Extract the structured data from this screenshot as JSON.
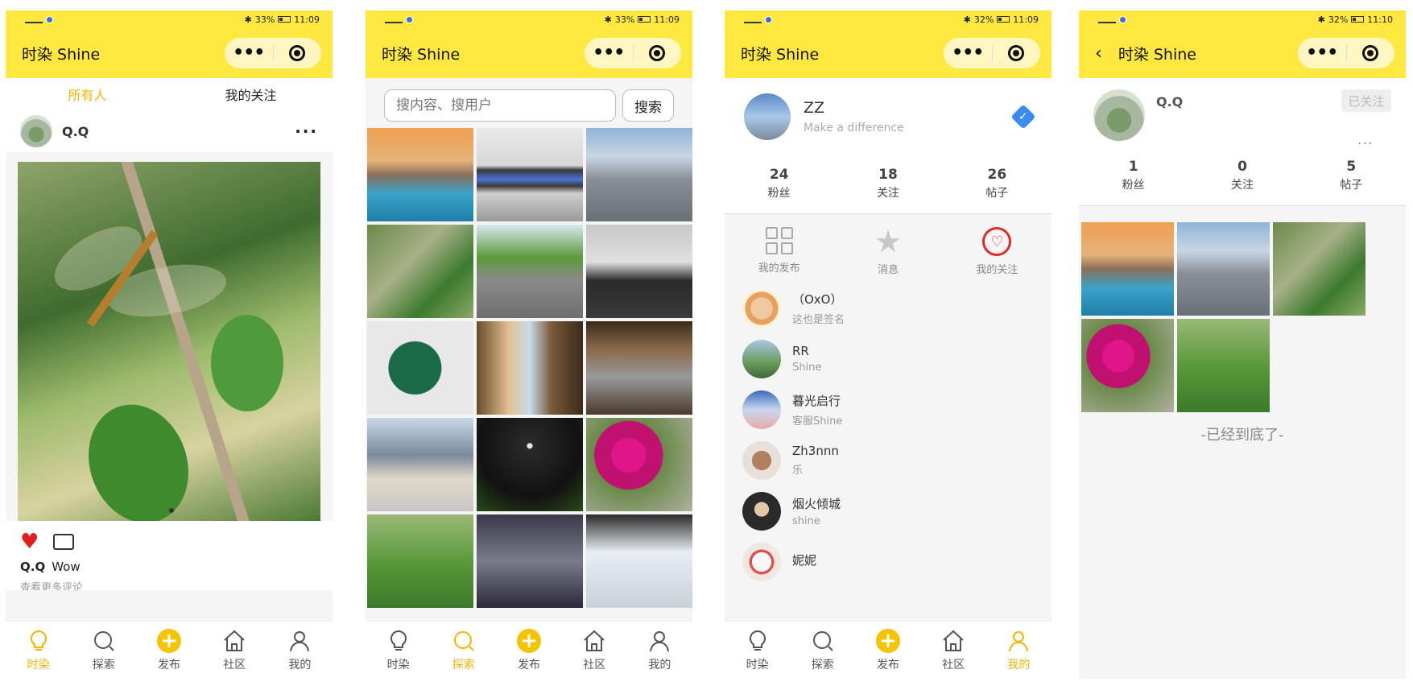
{
  "status": {
    "battery_1": "33%",
    "time_1": "11:09",
    "battery_2": "33%",
    "time_2": "11:09",
    "battery_3": "32%",
    "time_3": "11:09",
    "battery_4": "32%",
    "time_4": "11:10"
  },
  "app_title": "时染 Shine",
  "colors": {
    "accent": "#ffe83f",
    "tab_active": "#f2b600",
    "like": "#e02020",
    "verified": "#3a8cf0"
  },
  "tabbar": {
    "items": [
      {
        "label": "时染",
        "icon": "bulb-icon"
      },
      {
        "label": "探索",
        "icon": "search-icon"
      },
      {
        "label": "发布",
        "icon": "plus-icon"
      },
      {
        "label": "社区",
        "icon": "home-icon"
      },
      {
        "label": "我的",
        "icon": "user-icon"
      }
    ]
  },
  "feed": {
    "tabs": [
      "所有人",
      "我的关注"
    ],
    "post": {
      "user": "Q.Q",
      "more": "···",
      "caption_user": "Q.Q",
      "caption": "Wow",
      "comments_hint": "查看更多评论"
    }
  },
  "explore": {
    "search_placeholder": "搜内容、搜用户",
    "search_button": "搜索"
  },
  "me": {
    "name": "ZZ",
    "bio": "Make a difference",
    "verified_glyph": "✓",
    "stats": [
      {
        "value": "24",
        "label": "粉丝"
      },
      {
        "value": "18",
        "label": "关注"
      },
      {
        "value": "26",
        "label": "帖子"
      }
    ],
    "menu": [
      {
        "label": "我的发布",
        "icon": "grid-icon"
      },
      {
        "label": "消息",
        "icon": "star-icon"
      },
      {
        "label": "我的关注",
        "icon": "heart-icon"
      }
    ],
    "following": [
      {
        "name": "（OxO）",
        "sign": "这也是签名"
      },
      {
        "name": "RR",
        "sign": "Shine"
      },
      {
        "name": "暮光启行",
        "sign": "客服Shine"
      },
      {
        "name": "Zh3nnn",
        "sign": "乐"
      },
      {
        "name": "烟火倾城",
        "sign": "shine"
      },
      {
        "name": "妮妮",
        "sign": ""
      }
    ]
  },
  "user_page": {
    "name": "Q.Q",
    "follow_state": "已关注",
    "more": "···",
    "stats": [
      {
        "value": "1",
        "label": "粉丝"
      },
      {
        "value": "0",
        "label": "关注"
      },
      {
        "value": "5",
        "label": "帖子"
      }
    ],
    "end_tip": "-已经到底了-"
  }
}
